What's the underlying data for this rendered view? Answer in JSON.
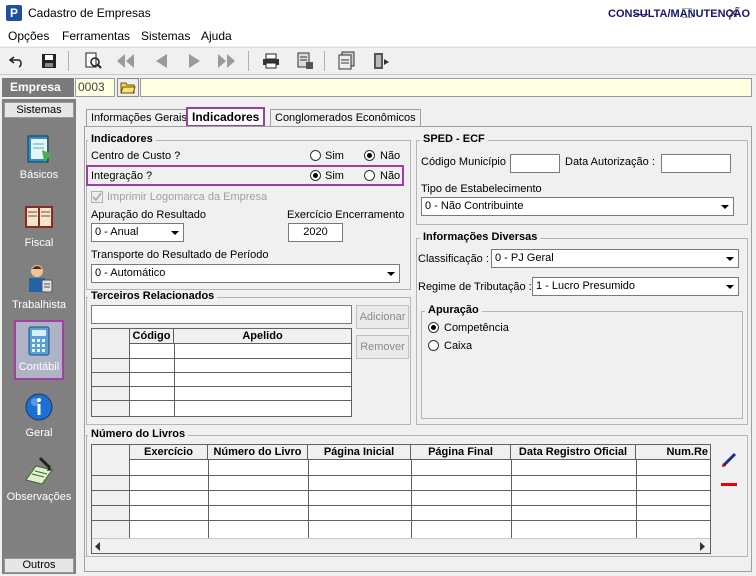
{
  "window": {
    "title": "Cadastro de Empresas",
    "app_icon": "P"
  },
  "menu": [
    "Opções",
    "Ferramentas",
    "Sistemas",
    "Ajuda"
  ],
  "toolbar": {
    "mode_label": "CONSULTA/MANUTENÇÃO"
  },
  "company": {
    "label": "Empresa",
    "code": "0003"
  },
  "sidebar": {
    "header": "Sistemas",
    "footer": "Outros",
    "items": [
      {
        "label": "Básicos",
        "icon": "book-icon"
      },
      {
        "label": "Fiscal",
        "icon": "ledger-icon"
      },
      {
        "label": "Trabalhista",
        "icon": "worker-icon"
      },
      {
        "label": "Contábil",
        "icon": "calculator-icon"
      },
      {
        "label": "Geral",
        "icon": "info-icon"
      },
      {
        "label": "Observações",
        "icon": "notepad-icon"
      }
    ]
  },
  "tabs": [
    "Informações Gerais",
    "Indicadores",
    "Conglomerados Econômicos"
  ],
  "indicadores": {
    "title": "Indicadores",
    "centro_custo_label": "Centro de Custo ?",
    "integracao_label": "Integração ?",
    "sim": "Sim",
    "nao": "Não",
    "imprimir_logo": "Imprimir Logomarca da Empresa",
    "apuracao_label": "Apuração do Resultado",
    "apuracao_value": "0 - Anual",
    "exercicio_label": "Exercício Encerramento",
    "exercicio_value": "2020",
    "transporte_label": "Transporte do Resultado de Período",
    "transporte_value": "0 - Automático"
  },
  "terceiros": {
    "title": "Terceiros Relacionados",
    "add_label": "Adicionar",
    "remove_label": "Remover",
    "columns": [
      "Código",
      "Apelido"
    ]
  },
  "sped": {
    "title": "SPED - ECF",
    "codigo_municipio": "Código Município :",
    "data_autorizacao": "Data Autorização :",
    "tipo_estab_label": "Tipo de Estabelecimento",
    "tipo_estab_value": "0 - Não Contribuinte"
  },
  "diversas": {
    "title": "Informações Diversas",
    "classificacao_label": "Classificação :",
    "classificacao_value": "0 - PJ Geral",
    "regime_label": "Regime de Tributação :",
    "regime_value": "1 - Lucro Presumido",
    "apuracao_title": "Apuração",
    "competencia": "Competência",
    "caixa": "Caixa"
  },
  "livros": {
    "title": "Número do Livros",
    "columns": [
      "Exercício",
      "Número do Livro",
      "Página Inicial",
      "Página Final",
      "Data Registro Oficial",
      "Num.Re"
    ]
  }
}
